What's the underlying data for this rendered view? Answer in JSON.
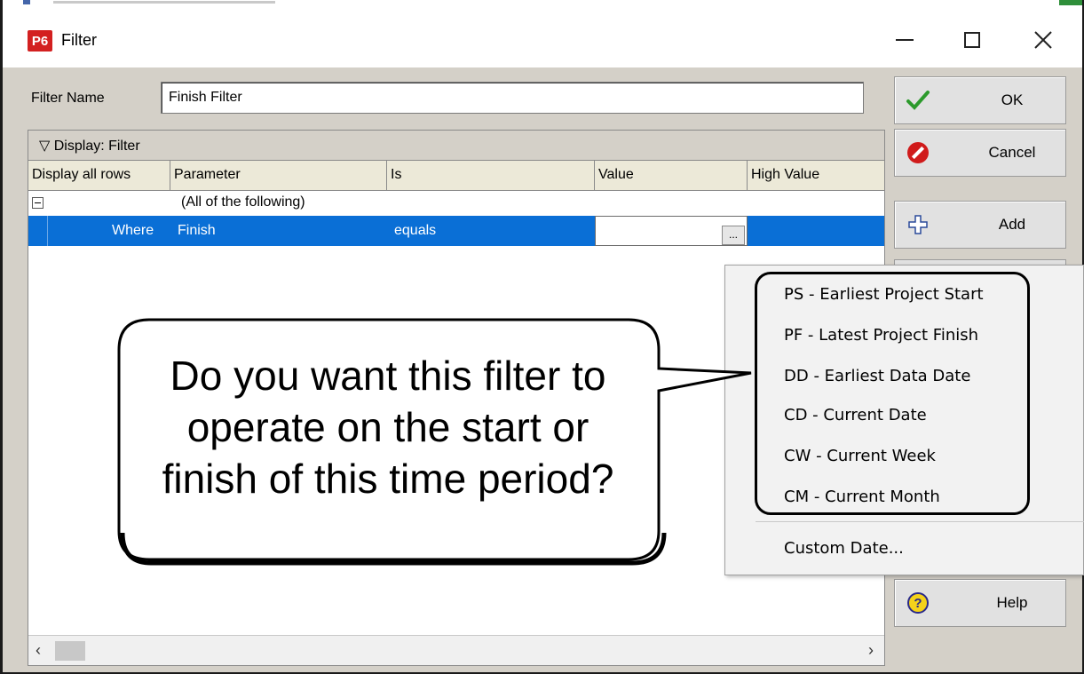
{
  "window": {
    "title": "Filter",
    "app_icon": "P6"
  },
  "filter_name": {
    "label": "Filter Name",
    "value": "Finish Filter"
  },
  "grid": {
    "group_bar": "Display: Filter",
    "columns": [
      "Display all rows",
      "Parameter",
      "Is",
      "Value",
      "High Value"
    ],
    "group_row": "(All of the following)",
    "selected_row": {
      "where": "Where",
      "parameter": "Finish",
      "is": "equals",
      "value": "",
      "ellipsis": "..."
    }
  },
  "buttons": {
    "ok": "OK",
    "cancel": "Cancel",
    "add": "Add",
    "help": "Help"
  },
  "menu": {
    "items": [
      "PS - Earliest Project Start",
      "PF - Latest Project Finish",
      "DD - Earliest Data Date",
      "CD - Current Date",
      "CW - Current Week",
      "CM - Current Month"
    ],
    "custom": "Custom Date..."
  },
  "callout": {
    "line1": "Do you want this filter to",
    "line2": "operate on the start or",
    "line3": "finish of this time period?"
  },
  "colors": {
    "selection": "#0a6fd6",
    "dialog_bg": "#d4d0c8",
    "app_icon_red": "#d32020"
  },
  "icons": {
    "ok": "checkmark-icon",
    "cancel": "cancel-icon",
    "add": "plus-icon",
    "help": "help-icon"
  }
}
